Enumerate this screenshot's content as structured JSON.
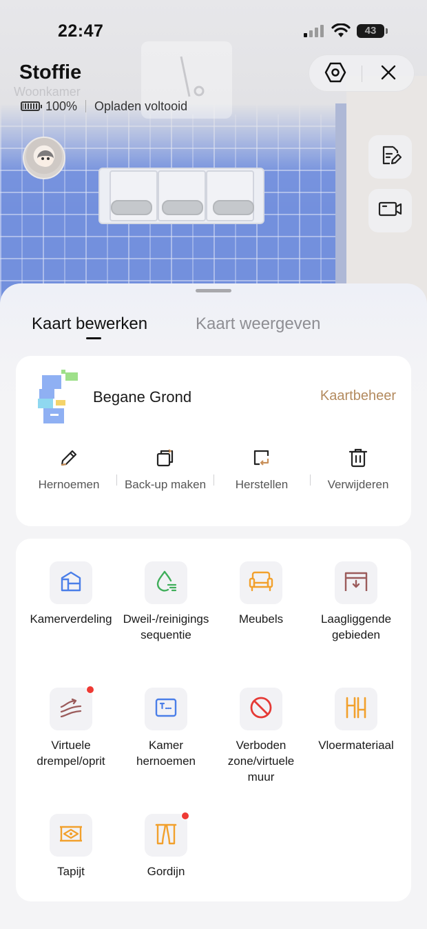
{
  "status_bar": {
    "time": "22:47",
    "battery_level": "43"
  },
  "header": {
    "robot_name": "Stoffie",
    "room_ghost_label": "Woonkamer",
    "battery_percent": "100%",
    "charge_status": "Opladen voltooid"
  },
  "icons": {
    "settings": "hexagon-settings-icon",
    "close": "close-icon",
    "edit_map": "map-edit-icon",
    "camera": "video-camera-icon"
  },
  "tabs": [
    {
      "label": "Kaart bewerken",
      "active": true
    },
    {
      "label": "Kaart weergeven",
      "active": false
    }
  ],
  "map": {
    "name": "Begane Grond",
    "manage_label": "Kaartbeheer",
    "actions": [
      {
        "label": "Hernoemen",
        "icon": "pencil-icon"
      },
      {
        "label": "Back-up maken",
        "icon": "backup-copy-icon"
      },
      {
        "label": "Herstellen",
        "icon": "restore-icon"
      },
      {
        "label": "Verwijderen",
        "icon": "trash-icon"
      }
    ]
  },
  "tools": [
    {
      "label": "Kamerverdeling",
      "icon": "room-divide-icon",
      "color": "#4a7ee8",
      "badge": false
    },
    {
      "label": "Dweil-/reinigingssequentie",
      "icon": "mop-sequence-icon",
      "color": "#3fae5a",
      "badge": false
    },
    {
      "label": "Meubels",
      "icon": "sofa-icon",
      "color": "#f2a02c",
      "badge": false
    },
    {
      "label": "Laagliggende gebieden",
      "icon": "low-area-icon",
      "color": "#9b5b5b",
      "badge": false
    },
    {
      "label": "Virtuele drempel/oprit",
      "icon": "threshold-ramp-icon",
      "color": "#9b5b5b",
      "badge": true
    },
    {
      "label": "Kamer hernoemen",
      "icon": "room-rename-icon",
      "color": "#4a7ee8",
      "badge": false
    },
    {
      "label": "Verboden zone/virtuele muur",
      "icon": "no-go-zone-icon",
      "color": "#e53935",
      "badge": false
    },
    {
      "label": "Vloermateriaal",
      "icon": "floor-material-icon",
      "color": "#f2a02c",
      "badge": false
    },
    {
      "label": "Tapijt",
      "icon": "carpet-icon",
      "color": "#f2a02c",
      "badge": false
    },
    {
      "label": "Gordijn",
      "icon": "curtain-icon",
      "color": "#f2a02c",
      "badge": true
    }
  ],
  "colors": {
    "accent_link": "#b38a5e",
    "badge": "#ee3a34"
  }
}
